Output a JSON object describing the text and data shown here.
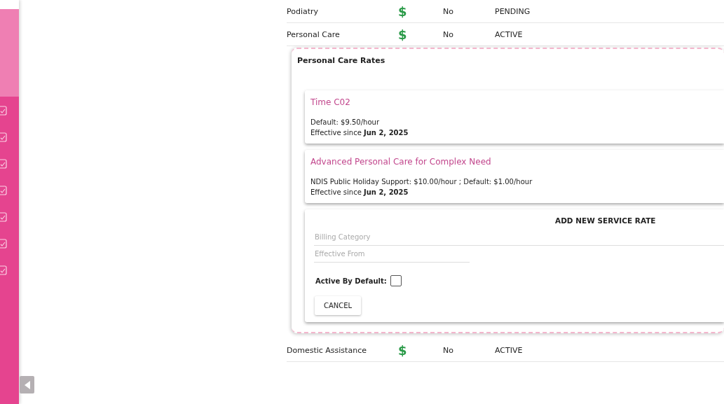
{
  "sidebar": {
    "nav_items": [
      {
        "kind": "task"
      },
      {
        "kind": "task"
      },
      {
        "kind": "task"
      },
      {
        "kind": "task"
      },
      {
        "kind": "task"
      },
      {
        "kind": "task"
      },
      {
        "kind": "task"
      }
    ]
  },
  "services": [
    {
      "name": "Podiatry",
      "col_2": "$",
      "col_3": "No",
      "status": "PENDING"
    },
    {
      "name": "Personal Care",
      "col_2": "$",
      "col_3": "No",
      "status": "ACTIVE",
      "rates_panel": {
        "title": "Personal Care Rates",
        "rates": [
          {
            "name": "Time C02",
            "details": "Default: $9.50/hour",
            "effective": "Effective since **Jun 2, 2025**"
          },
          {
            "name": "Advanced Personal Care for Complex Need",
            "details": "NDIS Public Holiday Support: $10.00/hour ; Default: $1.00/hour",
            "effective": "Effective since **Jun 2, 2025**"
          }
        ],
        "new_rate_form": {
          "title": "ADD NEW SERVICE RATE",
          "billing_category": {
            "placeholder": "Billing Category"
          },
          "effective_from": {
            "placeholder": "Effective From"
          },
          "active_by_default": {
            "label": "Active By Default:",
            "checked": false
          },
          "cancel": "CANCEL"
        }
      }
    },
    {
      "name": "Domestic Assistance",
      "col_2": "$",
      "col_3": "No",
      "status": "ACTIVE"
    }
  ]
}
